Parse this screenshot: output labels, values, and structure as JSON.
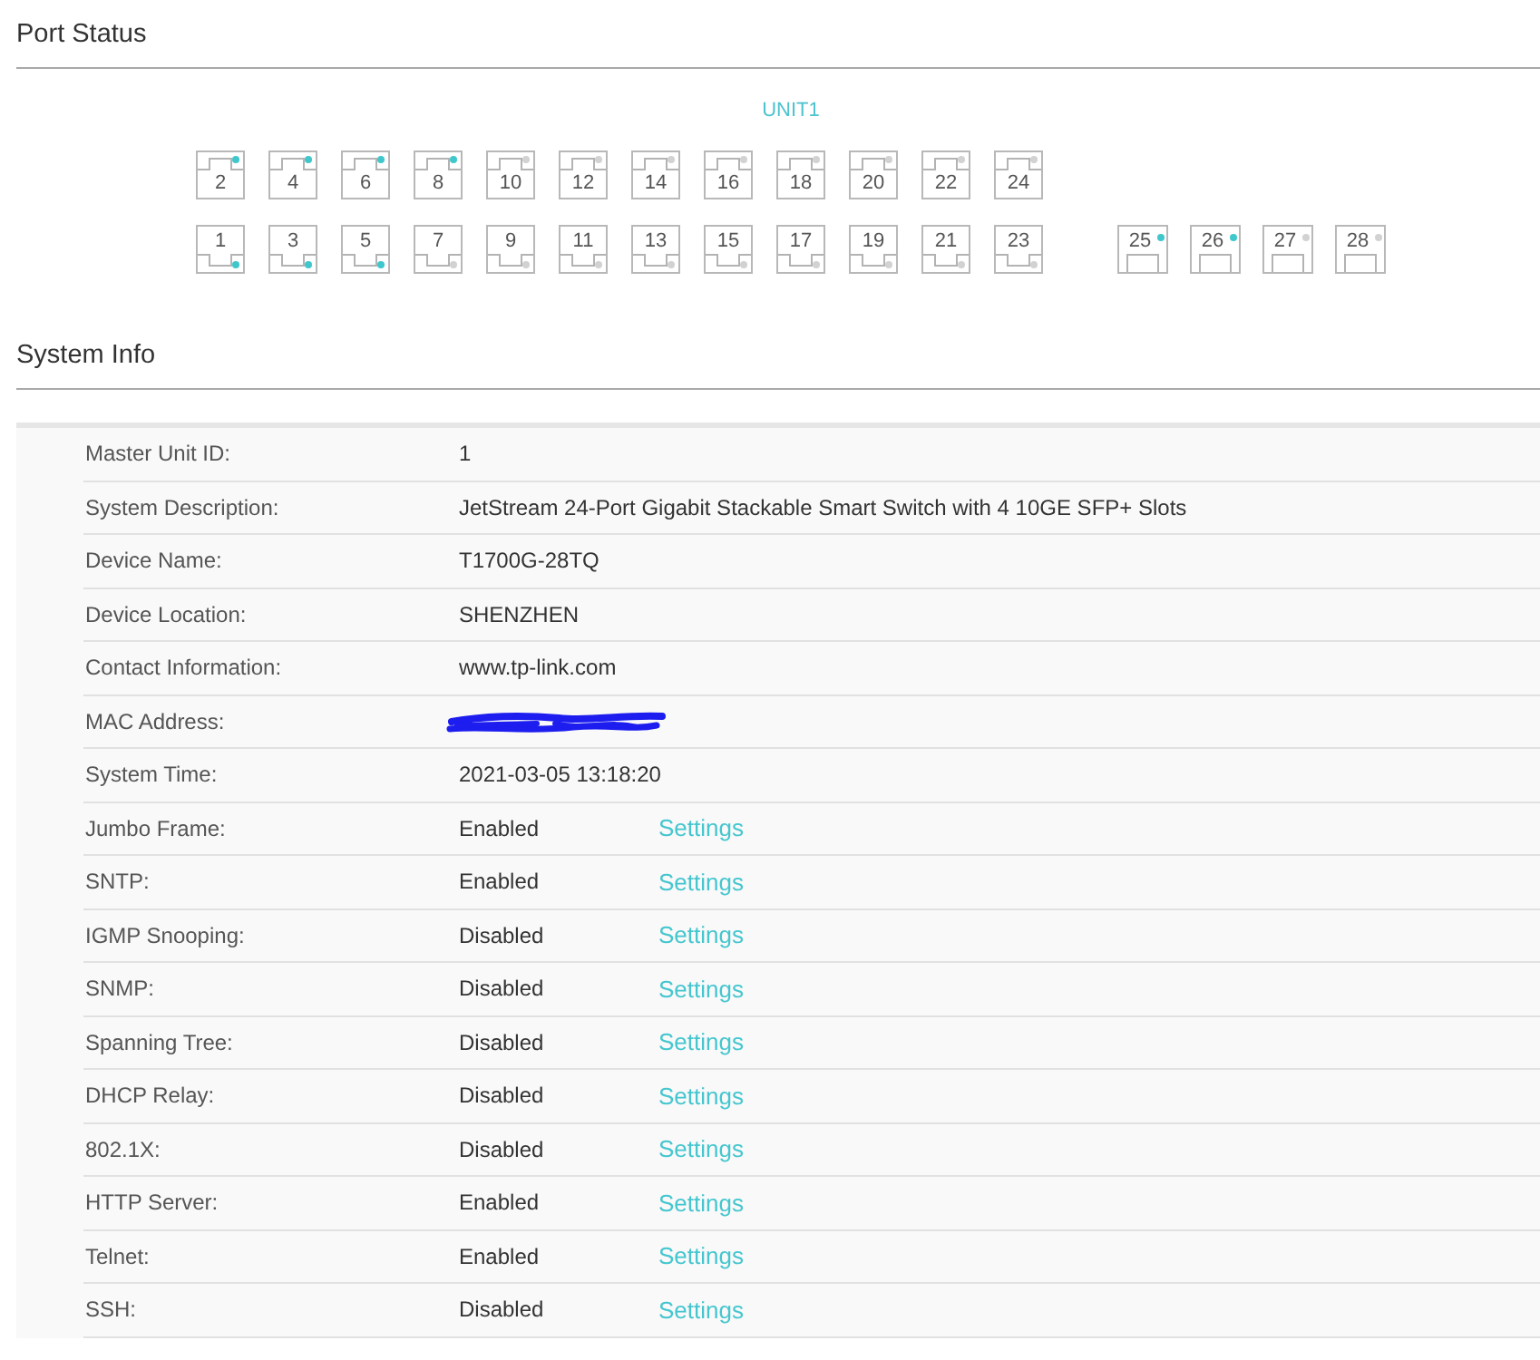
{
  "port_status": {
    "title": "Port Status",
    "unit_label": "UNIT1",
    "top_row": [
      {
        "number": "2",
        "linked": true
      },
      {
        "number": "4",
        "linked": true
      },
      {
        "number": "6",
        "linked": true
      },
      {
        "number": "8",
        "linked": true
      },
      {
        "number": "10",
        "linked": false
      },
      {
        "number": "12",
        "linked": false
      },
      {
        "number": "14",
        "linked": false
      },
      {
        "number": "16",
        "linked": false
      },
      {
        "number": "18",
        "linked": false
      },
      {
        "number": "20",
        "linked": false
      },
      {
        "number": "22",
        "linked": false
      },
      {
        "number": "24",
        "linked": false
      }
    ],
    "bottom_row": [
      {
        "number": "1",
        "linked": true
      },
      {
        "number": "3",
        "linked": true
      },
      {
        "number": "5",
        "linked": true
      },
      {
        "number": "7",
        "linked": false
      },
      {
        "number": "9",
        "linked": false
      },
      {
        "number": "11",
        "linked": false
      },
      {
        "number": "13",
        "linked": false
      },
      {
        "number": "15",
        "linked": false
      },
      {
        "number": "17",
        "linked": false
      },
      {
        "number": "19",
        "linked": false
      },
      {
        "number": "21",
        "linked": false
      },
      {
        "number": "23",
        "linked": false
      }
    ],
    "sfp_ports": [
      {
        "number": "25",
        "linked": true
      },
      {
        "number": "26",
        "linked": true
      },
      {
        "number": "27",
        "linked": false
      },
      {
        "number": "28",
        "linked": false
      }
    ]
  },
  "system_info": {
    "title": "System Info",
    "rows": [
      {
        "kind": "text",
        "label": "Master Unit ID:",
        "value": "1"
      },
      {
        "kind": "text",
        "label": "System Description:",
        "value": "JetStream 24-Port Gigabit Stackable Smart Switch with 4 10GE SFP+ Slots"
      },
      {
        "kind": "text",
        "label": "Device Name:",
        "value": "T1700G-28TQ"
      },
      {
        "kind": "text",
        "label": "Device Location:",
        "value": "SHENZHEN"
      },
      {
        "kind": "text",
        "label": "Contact Information:",
        "value": "www.tp-link.com"
      },
      {
        "kind": "redacted",
        "label": "MAC Address:"
      },
      {
        "kind": "text",
        "label": "System Time:",
        "value": "2021-03-05 13:18:20"
      },
      {
        "kind": "setting",
        "label": "Jumbo Frame:",
        "value": "Enabled",
        "link": "Settings"
      },
      {
        "kind": "setting",
        "label": "SNTP:",
        "value": "Enabled",
        "link": "Settings"
      },
      {
        "kind": "setting",
        "label": "IGMP Snooping:",
        "value": "Disabled",
        "link": "Settings"
      },
      {
        "kind": "setting",
        "label": "SNMP:",
        "value": "Disabled",
        "link": "Settings"
      },
      {
        "kind": "setting",
        "label": "Spanning Tree:",
        "value": "Disabled",
        "link": "Settings"
      },
      {
        "kind": "setting",
        "label": "DHCP Relay:",
        "value": "Disabled",
        "link": "Settings"
      },
      {
        "kind": "setting",
        "label": "802.1X:",
        "value": "Disabled",
        "link": "Settings"
      },
      {
        "kind": "setting",
        "label": "HTTP Server:",
        "value": "Enabled",
        "link": "Settings"
      },
      {
        "kind": "setting",
        "label": "Telnet:",
        "value": "Enabled",
        "link": "Settings"
      },
      {
        "kind": "setting",
        "label": "SSH:",
        "value": "Disabled",
        "link": "Settings"
      }
    ]
  }
}
